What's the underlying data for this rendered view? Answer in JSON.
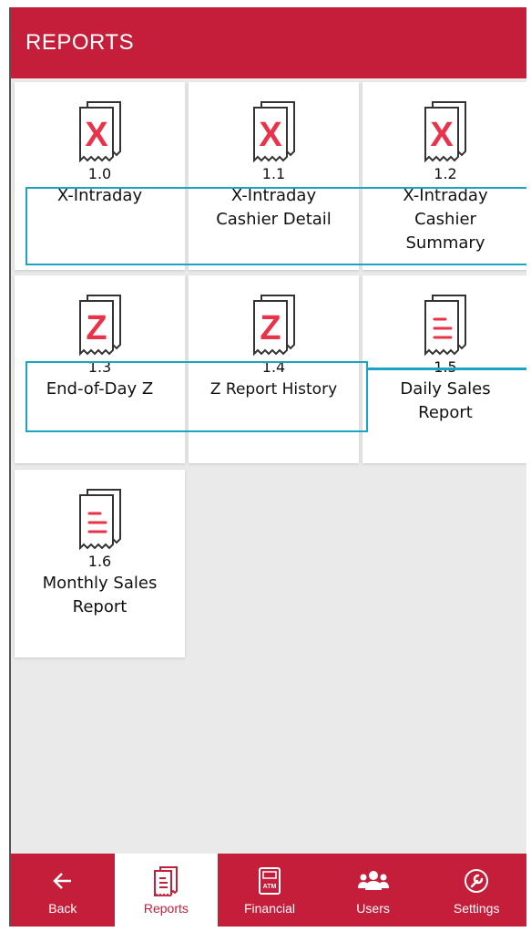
{
  "header": {
    "title": "REPORTS"
  },
  "tiles": [
    {
      "num": "1.0",
      "name": "X-Intraday",
      "icon": "x-receipt-icon"
    },
    {
      "num": "1.1",
      "name": "X-Intraday Cashier Detail",
      "icon": "x-receipt-icon"
    },
    {
      "num": "1.2",
      "name": "X-Intraday Cashier Summary",
      "icon": "x-receipt-icon"
    },
    {
      "num": "1.3",
      "name": "End-of-Day Z",
      "icon": "z-receipt-icon"
    },
    {
      "num": "1.4",
      "name": "Z Report History",
      "icon": "z-receipt-icon"
    },
    {
      "num": "1.5",
      "name": "Daily Sales Report",
      "icon": "sales-receipt-icon"
    },
    {
      "num": "1.6",
      "name": "Monthly Sales Report",
      "icon": "sales-receipt-icon"
    }
  ],
  "nav": [
    {
      "label": "Back",
      "icon": "back-arrow-icon"
    },
    {
      "label": "Reports",
      "icon": "reports-icon",
      "active": true
    },
    {
      "label": "Financial",
      "icon": "atm-icon"
    },
    {
      "label": "Users",
      "icon": "users-icon"
    },
    {
      "label": "Settings",
      "icon": "wrench-icon"
    }
  ],
  "colors": {
    "brand": "#c41e3a",
    "highlight": "#1aa5c2",
    "icon_red": "#e8334a"
  }
}
